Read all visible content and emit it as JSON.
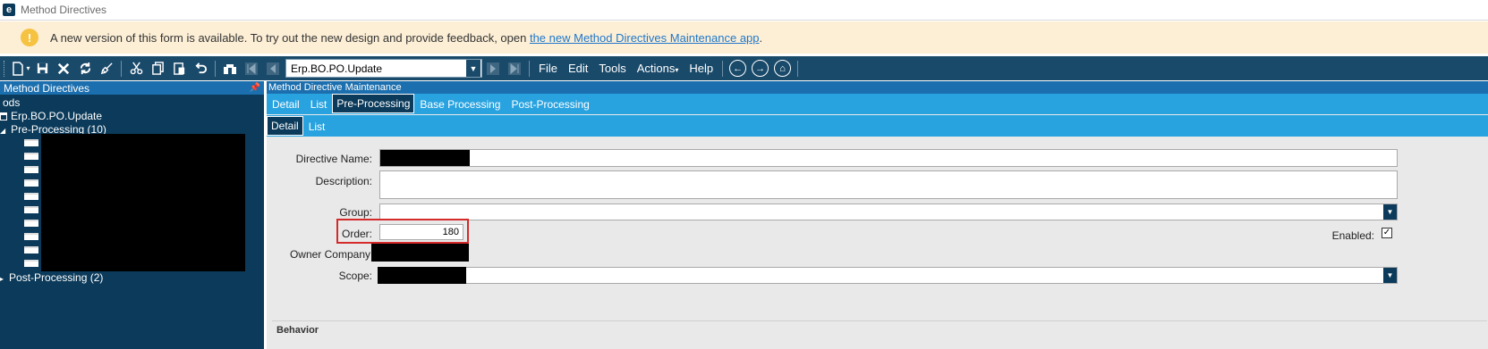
{
  "window": {
    "title": "Method Directives",
    "logo": "e"
  },
  "banner": {
    "text": "A new version of this form is available. To try out the new design and provide feedback, open ",
    "link": "the new Method Directives Maintenance app",
    "suffix": ".",
    "icon": "!"
  },
  "toolbar": {
    "combo_value": "Erp.BO.PO.Update",
    "menus": [
      "File",
      "Edit",
      "Tools",
      "Actions",
      "Help"
    ]
  },
  "tree": {
    "header": "Method Directives",
    "root": "ods",
    "method": "Erp.BO.PO.Update",
    "pre_processing": "Pre-Processing (10)",
    "post_processing": "Post-Processing (2)"
  },
  "main": {
    "header": "Method Directive Maintenance",
    "tabs": [
      "Detail",
      "List",
      "Pre-Processing",
      "Base Processing",
      "Post-Processing"
    ],
    "subtabs": [
      "Detail",
      "List"
    ]
  },
  "form": {
    "directive_name_label": "Directive Name:",
    "description_label": "Description:",
    "group_label": "Group:",
    "order_label": "Order:",
    "order_value": "180",
    "owner_company_label": "Owner Company",
    "scope_label": "Scope:",
    "enabled_label": "Enabled:",
    "enabled_checked": true,
    "behavior_label": "Behavior"
  },
  "colors": {
    "toolbar": "#1a4a6a",
    "panel_dark": "#0b3a5a",
    "tab_bar": "#29a3e0",
    "banner_bg": "#fdefd6",
    "highlight": "#d42a2a"
  }
}
